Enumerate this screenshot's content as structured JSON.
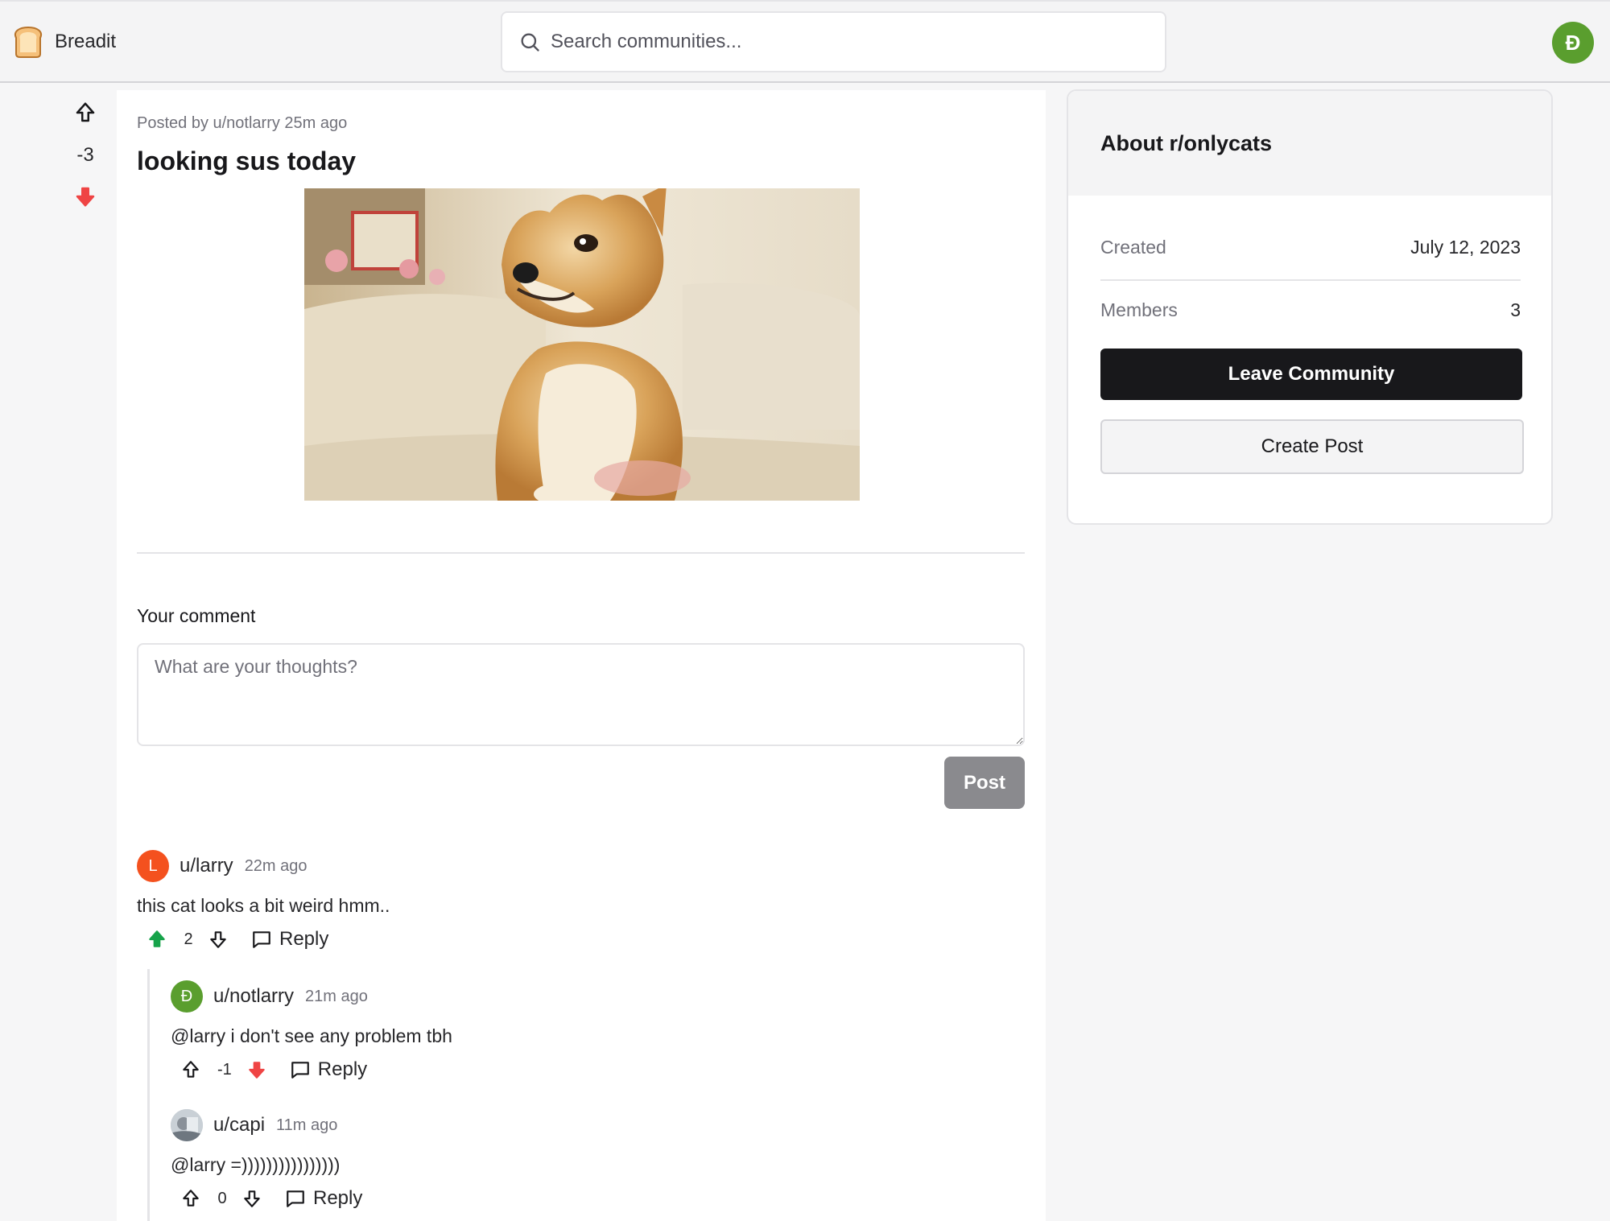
{
  "header": {
    "brand": "Breadit",
    "search_placeholder": "Search communities...",
    "user_initial": "Đ"
  },
  "post": {
    "score": "-3",
    "vote_state": "downvoted",
    "meta": "Posted by u/notlarry 25m ago",
    "title": "looking sus today",
    "comment_label": "Your comment",
    "comment_placeholder": "What are your thoughts?",
    "post_button": "Post"
  },
  "comments": [
    {
      "initial": "L",
      "avatar_color": "#f4511e",
      "user": "u/larry",
      "time": "22m ago",
      "text": "this cat looks a bit weird hmm..",
      "score": "2",
      "vote_state": "upvoted",
      "reply_label": "Reply"
    },
    {
      "initial": "Đ",
      "avatar_color": "#5a9e2e",
      "user": "u/notlarry",
      "time": "21m ago",
      "text": "@larry i don't see any problem tbh",
      "score": "-1",
      "vote_state": "downvoted",
      "reply_label": "Reply"
    },
    {
      "initial": "",
      "avatar_color": "#b9c1c9",
      "user": "u/capi",
      "time": "11m ago",
      "text": "@larry =))))))))))))))))",
      "score": "0",
      "vote_state": "none",
      "reply_label": "Reply"
    }
  ],
  "sidebar": {
    "title": "About r/onlycats",
    "created_label": "Created",
    "created_value": "July 12, 2023",
    "members_label": "Members",
    "members_value": "3",
    "leave_button": "Leave Community",
    "create_button": "Create Post"
  },
  "colors": {
    "upvote_active": "#16a34a",
    "downvote_active": "#ef4444",
    "neutral_icon": "#18181b"
  }
}
